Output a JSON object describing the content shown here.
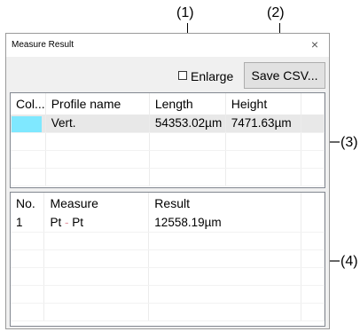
{
  "callouts": {
    "c1": "(1)",
    "c2": "(2)",
    "c3": "(3)",
    "c4": "(4)"
  },
  "window": {
    "title": "Measure Result",
    "close_glyph": "×"
  },
  "toolbar": {
    "enlarge_label": "Enlarge",
    "enlarge_checked": false,
    "save_csv_label": "Save CSV..."
  },
  "profiles": {
    "headers": [
      "Col...",
      "Profile name",
      "Length",
      "Height"
    ],
    "rows": [
      {
        "color": "#7fe8ff",
        "name": "Vert.",
        "length": "54353.02µm",
        "height": "7471.63µm"
      }
    ]
  },
  "measures": {
    "headers": [
      "No.",
      "Measure",
      "Result"
    ],
    "rows": [
      {
        "no": "1",
        "measure_from": "Pt",
        "measure_sep": " - ",
        "measure_to": "Pt",
        "result": "12558.19µm"
      }
    ]
  }
}
